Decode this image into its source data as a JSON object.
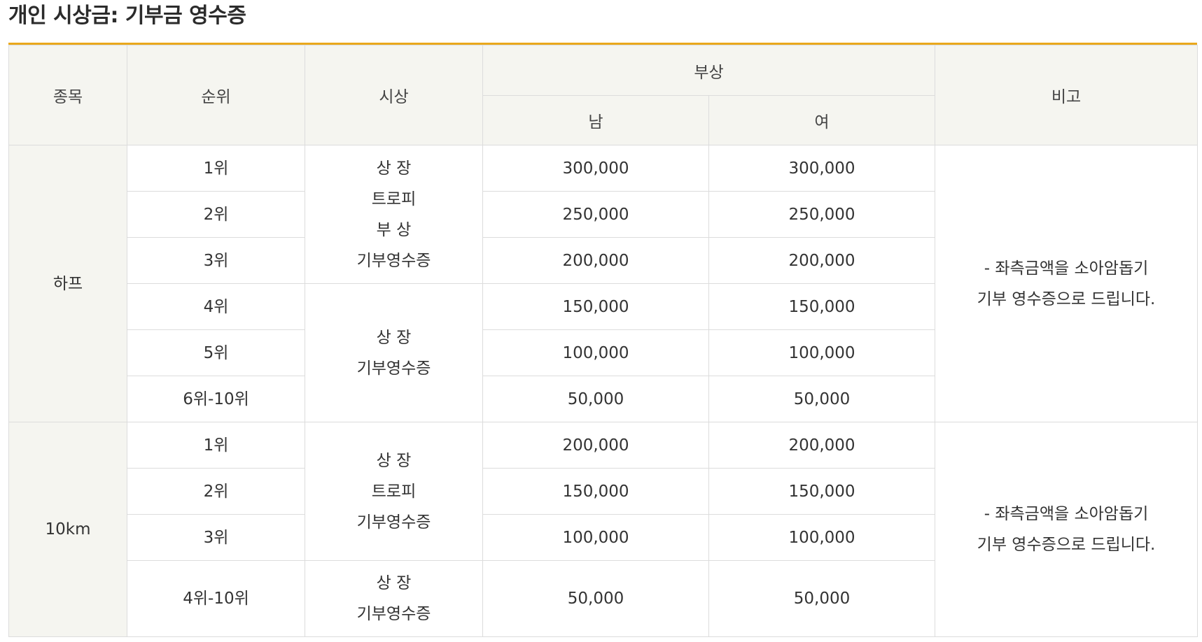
{
  "title": "개인 시상금: 기부금 영수증",
  "colors": {
    "accent": "#eaa81c",
    "header_bg": "#f5f5f0",
    "border": "#dcdcdc"
  },
  "headers": {
    "event": "종목",
    "rank": "순위",
    "award": "시상",
    "prize": "부상",
    "male": "남",
    "female": "여",
    "remarks": "비고"
  },
  "half": {
    "event": "하프",
    "rows": [
      {
        "rank": "1위",
        "male": "300,000",
        "female": "300,000"
      },
      {
        "rank": "2위",
        "male": "250,000",
        "female": "250,000"
      },
      {
        "rank": "3위",
        "male": "200,000",
        "female": "200,000"
      },
      {
        "rank": "4위",
        "male": "150,000",
        "female": "150,000"
      },
      {
        "rank": "5위",
        "male": "100,000",
        "female": "100,000"
      },
      {
        "rank": "6위-10위",
        "male": "50,000",
        "female": "50,000"
      }
    ],
    "award_top": [
      "상 장",
      "트로피",
      "부 상",
      "기부영수증"
    ],
    "award_bottom": [
      "상 장",
      "기부영수증"
    ],
    "note": [
      "- 좌측금액을 소아암돕기",
      "기부 영수증으로 드립니다."
    ]
  },
  "tenk": {
    "event": "10km",
    "rows": [
      {
        "rank": "1위",
        "male": "200,000",
        "female": "200,000"
      },
      {
        "rank": "2위",
        "male": "150,000",
        "female": "150,000"
      },
      {
        "rank": "3위",
        "male": "100,000",
        "female": "100,000"
      },
      {
        "rank": "4위-10위",
        "male": "50,000",
        "female": "50,000"
      }
    ],
    "award_top": [
      "상 장",
      "트로피",
      "기부영수증"
    ],
    "award_bottom": [
      "상 장",
      "기부영수증"
    ],
    "note": [
      "- 좌측금액을 소아암돕기",
      "기부 영수증으로 드립니다."
    ]
  }
}
